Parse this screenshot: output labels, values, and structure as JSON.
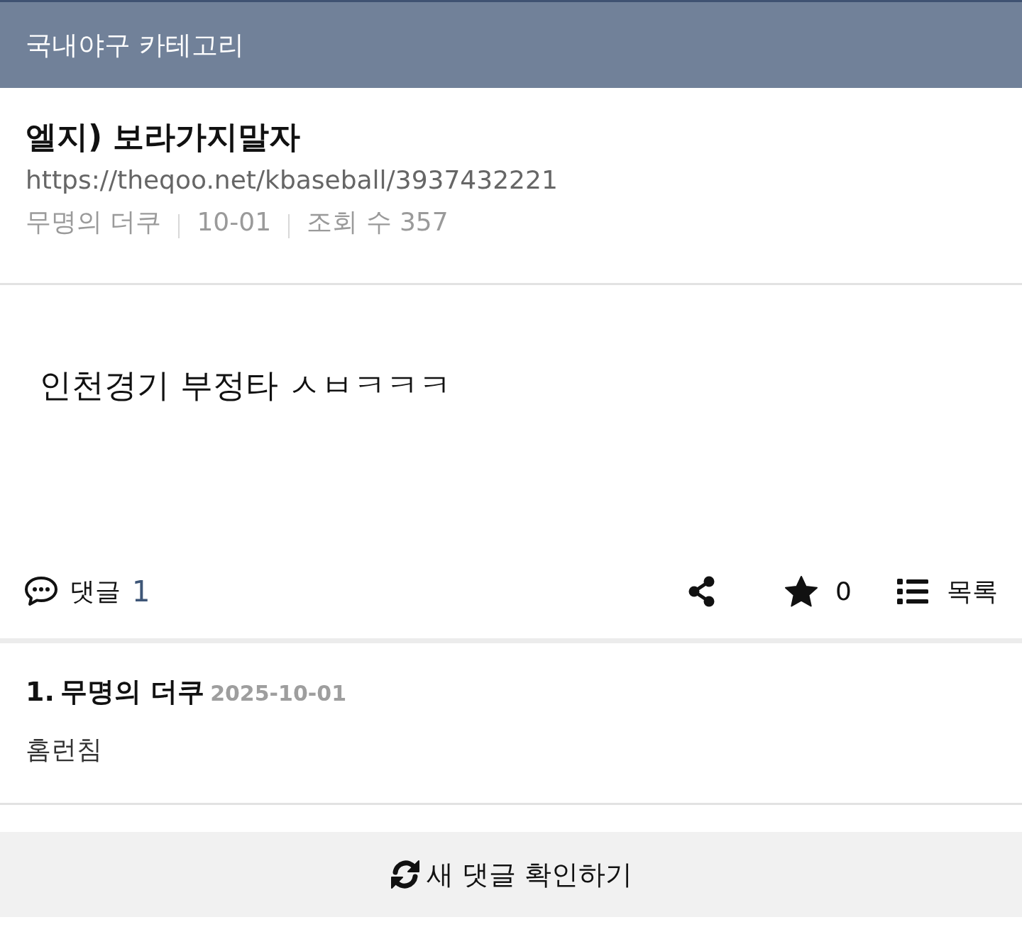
{
  "header": {
    "title": "국내야구 카테고리"
  },
  "post": {
    "title": "엘지) 보라가지말자",
    "url": "https://theqoo.net/kbaseball/3937432221",
    "meta": [
      "무명의 더쿠",
      "10-01",
      "조회 수 357"
    ],
    "body": "인천경기 부정타 ㅅㅂㅋㅋㅋ"
  },
  "actions": {
    "comments_label": "댓글",
    "comments_count": "1",
    "likes": "0",
    "list_label": "목록"
  },
  "comments": [
    {
      "number": "1.",
      "author": "무명의 더쿠",
      "date": "2025-10-01",
      "text": "홈런침"
    }
  ],
  "refresh_button": {
    "label": "새 댓글 확인하기"
  }
}
